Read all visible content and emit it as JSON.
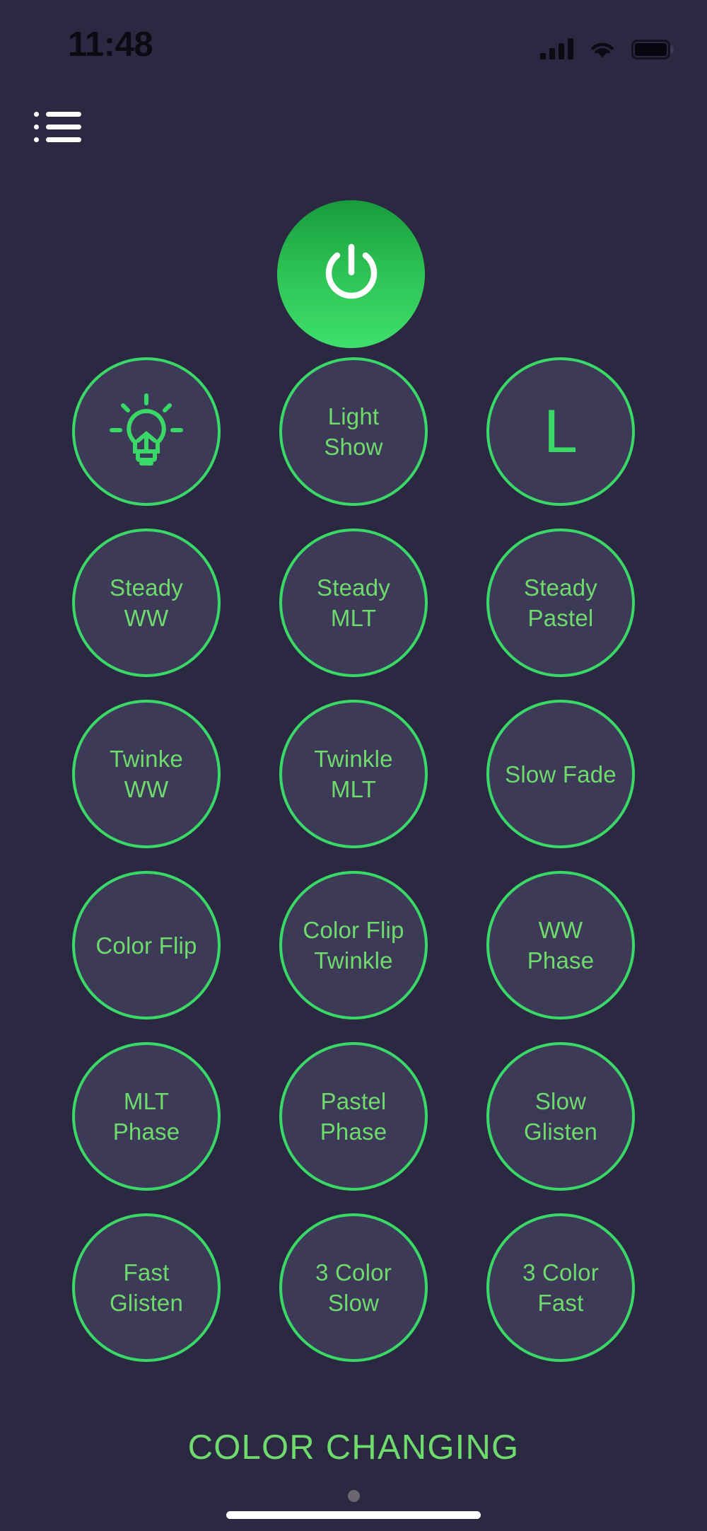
{
  "statusbar": {
    "time": "11:48",
    "cellular_icon": "cellular-signal-icon",
    "wifi_icon": "wifi-icon",
    "battery_icon": "battery-full-icon"
  },
  "header": {
    "menu_icon": "list-menu-icon",
    "power_button_label": "power-icon"
  },
  "colors": {
    "background": "#2b2842",
    "circle_fill": "#3d3a58",
    "accent_green": "#3ad867",
    "text_green": "#6fdb6c",
    "power_gradient_top": "#189b3d",
    "power_gradient_bottom": "#3ee06b",
    "home_indicator": "#ffffff",
    "page_dot": "#6b6670"
  },
  "grid": {
    "rows": [
      [
        {
          "label": "",
          "kind": "icon",
          "icon": "light-bulb-icon"
        },
        {
          "label": "Light\nShow",
          "kind": "text"
        },
        {
          "label": "L",
          "kind": "letter"
        }
      ],
      [
        {
          "label": "Steady\nWW",
          "kind": "text"
        },
        {
          "label": "Steady\nMLT",
          "kind": "text"
        },
        {
          "label": "Steady\nPastel",
          "kind": "text"
        }
      ],
      [
        {
          "label": "Twinke\nWW",
          "kind": "text"
        },
        {
          "label": "Twinkle\nMLT",
          "kind": "text"
        },
        {
          "label": "Slow Fade",
          "kind": "text"
        }
      ],
      [
        {
          "label": "Color Flip",
          "kind": "text"
        },
        {
          "label": "Color Flip\nTwinkle",
          "kind": "text"
        },
        {
          "label": "WW\nPhase",
          "kind": "text"
        }
      ],
      [
        {
          "label": "MLT\nPhase",
          "kind": "text"
        },
        {
          "label": "Pastel\nPhase",
          "kind": "text"
        },
        {
          "label": "Slow\nGlisten",
          "kind": "text"
        }
      ],
      [
        {
          "label": "Fast\nGlisten",
          "kind": "text"
        },
        {
          "label": "3 Color\nSlow",
          "kind": "text"
        },
        {
          "label": "3 Color\nFast",
          "kind": "text"
        }
      ]
    ]
  },
  "footer": {
    "title": "COLOR CHANGING",
    "page_dots": 1,
    "home_indicator": "home-indicator"
  }
}
